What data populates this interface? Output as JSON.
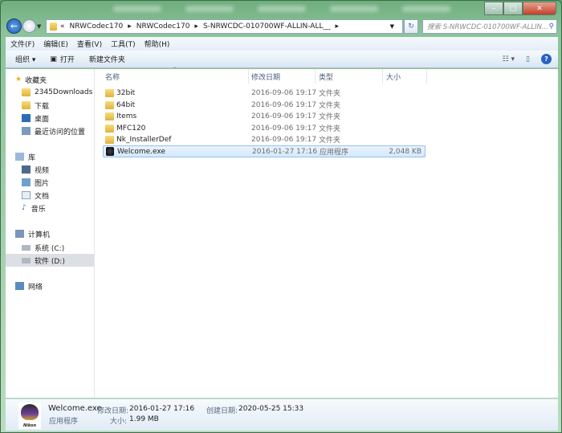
{
  "window": {
    "controls": [
      "minimize",
      "maximize",
      "close"
    ]
  },
  "address": {
    "history_glyph": "«",
    "crumbs": [
      "NRWCodec170",
      "NRWCodec170",
      "S-NRWCDC-010700WF-ALLIN-ALL__"
    ],
    "search_placeholder": "搜索 S-NRWCDC-010700WF-ALLIN..."
  },
  "menu": [
    "文件(F)",
    "编辑(E)",
    "查看(V)",
    "工具(T)",
    "帮助(H)"
  ],
  "toolbar": {
    "organize": "组织 ▾",
    "open": "打开",
    "new_folder": "新建文件夹"
  },
  "sidebar": {
    "favorites": {
      "label": "收藏夹",
      "items": [
        "2345Downloads",
        "下载",
        "桌面",
        "最近访问的位置"
      ]
    },
    "libraries": {
      "label": "库",
      "items": [
        "视频",
        "图片",
        "文档",
        "音乐"
      ]
    },
    "computer": {
      "label": "计算机",
      "items": [
        "系统 (C:)",
        "软件 (D:)"
      ]
    },
    "network": {
      "label": "网络"
    }
  },
  "columns": {
    "name": "名称",
    "date": "修改日期",
    "type": "类型",
    "size": "大小"
  },
  "files": [
    {
      "name": "32bit",
      "date": "2016-09-06 19:17",
      "type": "文件夹",
      "size": ""
    },
    {
      "name": "64bit",
      "date": "2016-09-06 19:17",
      "type": "文件夹",
      "size": ""
    },
    {
      "name": "Items",
      "date": "2016-09-06 19:17",
      "type": "文件夹",
      "size": ""
    },
    {
      "name": "MFC120",
      "date": "2016-09-06 19:17",
      "type": "文件夹",
      "size": ""
    },
    {
      "name": "Nk_InstallerDef",
      "date": "2016-09-06 19:17",
      "type": "文件夹",
      "size": ""
    },
    {
      "name": "Welcome.exe",
      "date": "2016-01-27 17:16",
      "type": "应用程序",
      "size": "2,048 KB"
    }
  ],
  "details": {
    "name": "Welcome.exe",
    "type": "应用程序",
    "modified_label": "修改日期:",
    "modified": "2016-01-27 17:16",
    "created_label": "创建日期:",
    "created": "2020-05-25 15:33",
    "size_label": "大小:",
    "size": "1.99 MB",
    "logo_text": "Nikon"
  }
}
